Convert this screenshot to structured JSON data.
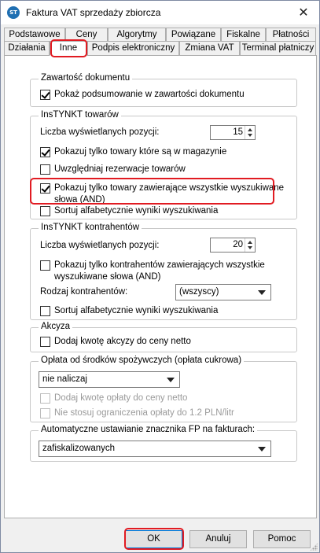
{
  "window": {
    "title": "Faktura VAT sprzedaży zbiorcza",
    "icon": "ST",
    "close_glyph": "✕"
  },
  "tabs_row1": [
    "Podstawowe",
    "Ceny",
    "Algorytmy",
    "Powiązane",
    "Fiskalne",
    "Płatności"
  ],
  "tabs_row2": [
    "Działania",
    "Inne",
    "Podpis elektroniczny",
    "Zmiana VAT",
    "Terminal płatniczy"
  ],
  "active_tab": "Inne",
  "groups": {
    "zawartosc": {
      "title": "Zawartość dokumentu",
      "show_summary": {
        "label": "Pokaż podsumowanie w zawartości dokumentu",
        "checked": true
      }
    },
    "instynkt_towarow": {
      "title": "InsTYNKT towarów",
      "count_label": "Liczba wyświetlanych pozycji:",
      "count_value": "15",
      "only_in_stock": {
        "label": "Pokazuj tylko towary które są w magazynie",
        "checked": true
      },
      "reservations": {
        "label": "Uwzględniaj rezerwacje towarów",
        "checked": false
      },
      "all_words": {
        "label_line1": "Pokazuj tylko towary zawierające wszystkie wyszukiwane",
        "label_line2": "słowa (AND)",
        "checked": true
      },
      "sort_alpha": {
        "label": "Sortuj alfabetycznie wyniki wyszukiwania",
        "checked": false
      }
    },
    "instynkt_kontrahentow": {
      "title": "InsTYNKT kontrahentów",
      "count_label": "Liczba wyświetlanych pozycji:",
      "count_value": "20",
      "all_words": {
        "label_line1": "Pokazuj tylko kontrahentów zawierających wszystkie",
        "label_line2": "wyszukiwane słowa (AND)",
        "checked": false
      },
      "type_label": "Rodzaj kontrahentów:",
      "type_value": "(wszyscy)",
      "sort_alpha": {
        "label": "Sortuj alfabetycznie wyniki wyszukiwania",
        "checked": false
      }
    },
    "akcyza": {
      "title": "Akcyza",
      "add_to_price": {
        "label": "Dodaj kwotę akcyzy do ceny netto",
        "checked": false
      }
    },
    "oplata": {
      "title": "Opłata od środków spożywczych (opłata cukrowa)",
      "select_value": "nie naliczaj",
      "add_to_price": {
        "label": "Dodaj kwotę opłaty do ceny netto",
        "checked": false,
        "disabled": true
      },
      "no_limit": {
        "label": "Nie stosuj ograniczenia opłaty do 1.2 PLN/litr",
        "checked": false,
        "disabled": true
      }
    },
    "fp": {
      "title": "Automatyczne ustawianie znacznika FP na fakturach:",
      "select_value": "zafiskalizowanych"
    }
  },
  "buttons": {
    "ok": "OK",
    "cancel": "Anuluj",
    "help": "Pomoc"
  },
  "colors": {
    "highlight": "#e11b22",
    "accent": "#0078d7"
  }
}
